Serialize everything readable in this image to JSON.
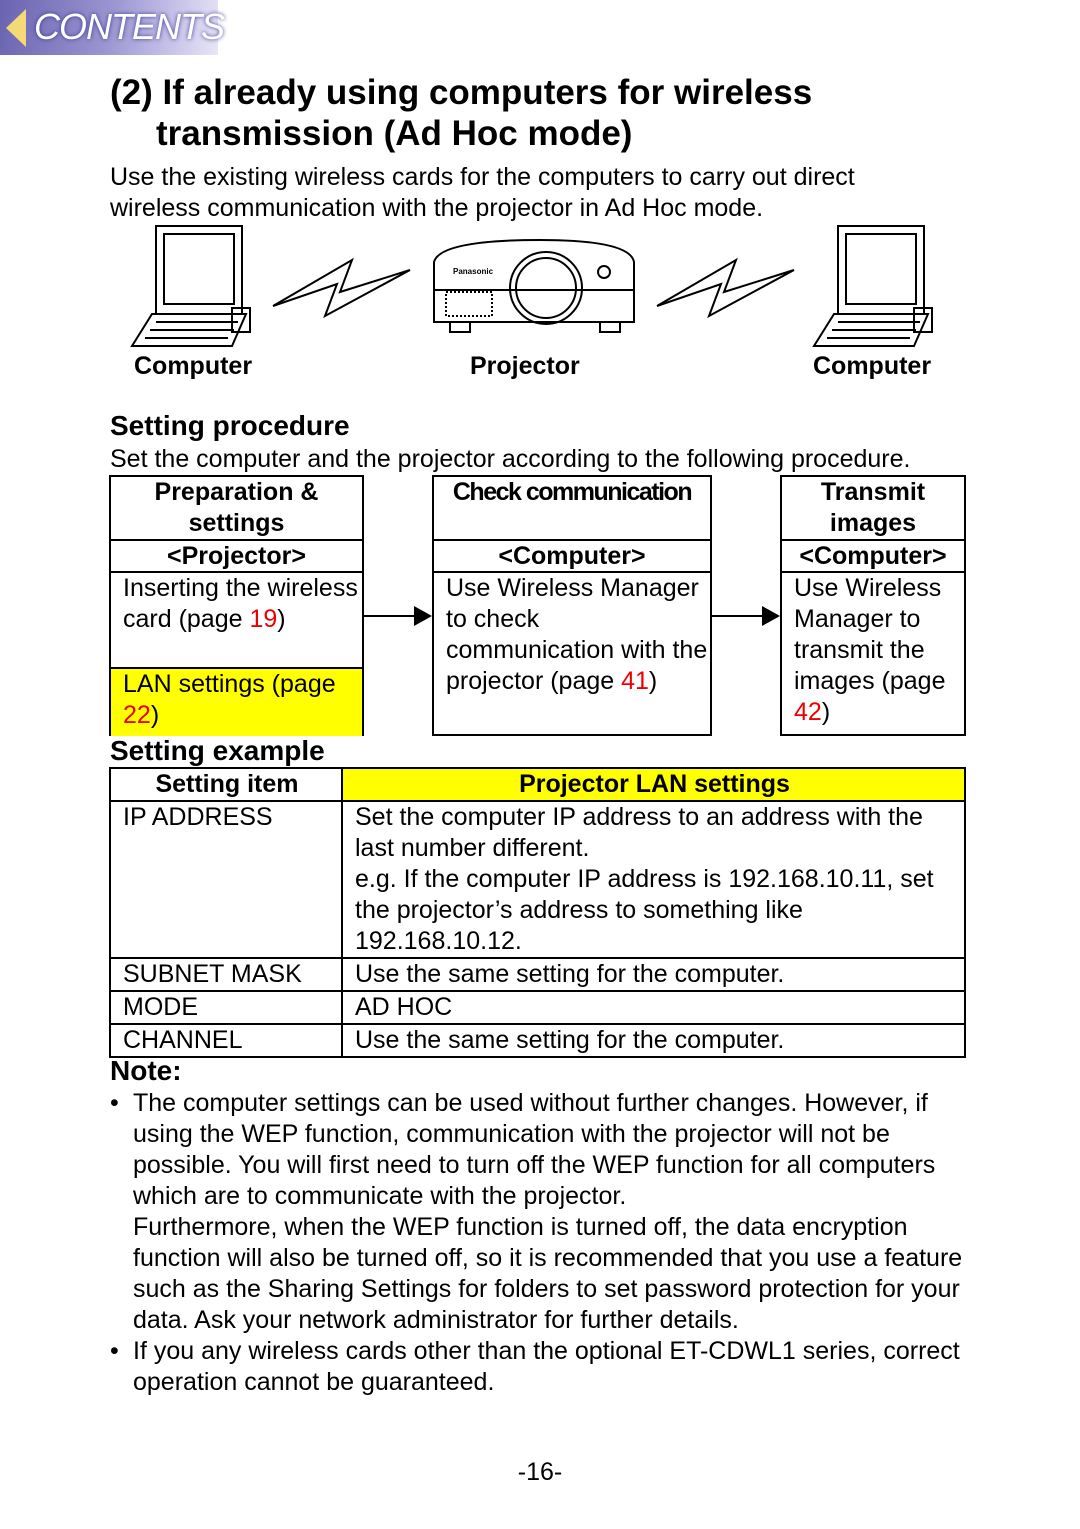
{
  "nav": {
    "contents_label": "CONTENTS"
  },
  "title": {
    "line1": "(2) If already using computers for wireless",
    "line2": "transmission (Ad Hoc mode)"
  },
  "intro": "Use the existing wireless cards for the computers to carry out direct wireless communication with the projector in Ad Hoc mode.",
  "diagram": {
    "left": "Computer",
    "center": "Projector",
    "right": "Computer",
    "brand": "Panasonic"
  },
  "procedure": {
    "heading": "Setting procedure",
    "text": "Set the computer and the projector according to the following procedure.",
    "steps": [
      {
        "title": "Preparation & settings",
        "device": "<Projector>",
        "item1": "Inserting the wireless card (page ",
        "item1_page": "19",
        "item2": "LAN settings (page ",
        "item2_page": "22"
      },
      {
        "title": "Check communication",
        "device": "<Computer>",
        "item1": "Use Wireless Manager to check communication with the projector (page ",
        "item1_page": "41"
      },
      {
        "title": "Transmit images",
        "device": "<Computer>",
        "item1": "Use Wireless Manager to transmit the images (page ",
        "item1_page": "42"
      }
    ],
    "close_paren": ")",
    "highlight_color": "#ffff00",
    "page_link_color": "#ee0000"
  },
  "example": {
    "heading": "Setting example",
    "headers": [
      "Setting item",
      "Projector LAN settings"
    ],
    "rows": [
      {
        "item": "IP ADDRESS",
        "value": "Set the computer IP address to an address with the last number different.",
        "value2": "e.g. If the computer IP address is 192.168.10.11, set the projector’s address to something like 192.168.10.12."
      },
      {
        "item": "SUBNET MASK",
        "value": "Use the same setting for the computer."
      },
      {
        "item": "MODE",
        "value": "AD HOC"
      },
      {
        "item": "CHANNEL",
        "value": "Use the same setting for the computer."
      }
    ]
  },
  "note": {
    "heading": "Note:",
    "bullets": [
      {
        "p1": "The computer settings can be used without further changes. However, if using the WEP function, communication with the projector will not be possible. You will first need to turn off the WEP function for all computers which are to communicate with the projector.",
        "p2": "Furthermore, when the WEP function is turned off, the data encryption function will also be turned off, so it is recommended that you use a feature such as the Sharing Settings for folders to set password protection for your data. Ask your network administrator for further details."
      },
      {
        "p1": "If you any wireless cards other than the optional ET-CDWL1 series, correct operation cannot be guaranteed."
      }
    ]
  },
  "page_number": "-16-"
}
